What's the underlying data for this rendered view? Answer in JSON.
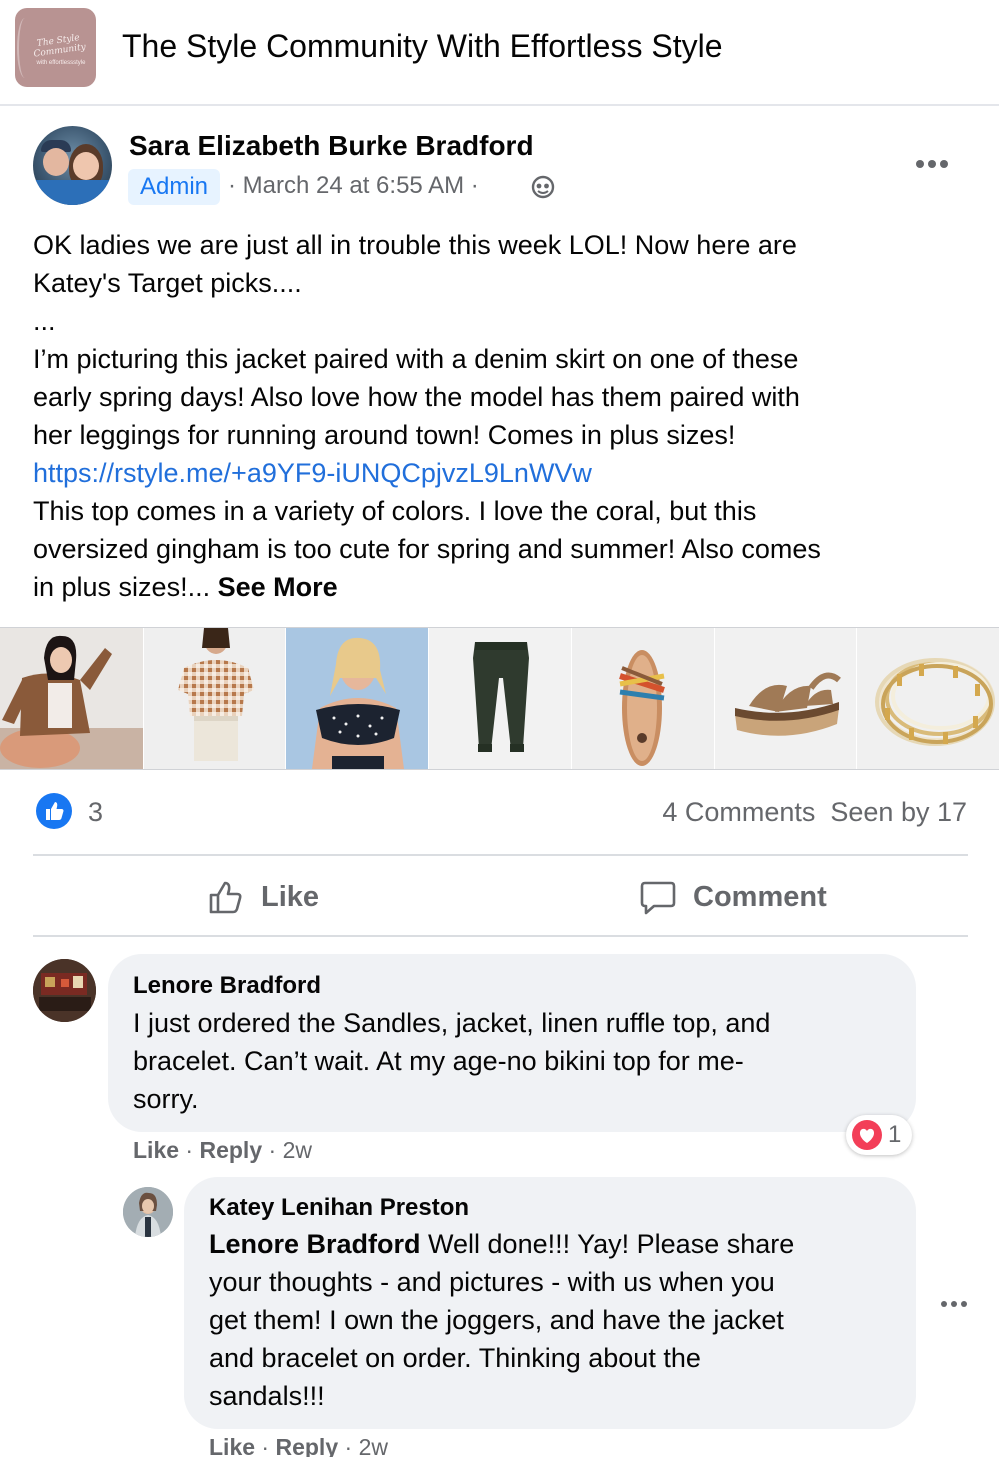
{
  "group": {
    "name": "The Style Community With Effortless Style",
    "logo_script": "The Style Community",
    "logo_sub": "with effortlessstyle",
    "logo_color": "#b89392"
  },
  "post": {
    "author": "Sara Elizabeth Burke Bradford",
    "badge": "Admin",
    "meta": "· March 24 at 6:55 AM ·",
    "privacy_icon": "globe-icon",
    "body_lines": [
      "OK ladies we are just all in trouble this week LOL!  Now here are",
      "Katey's Target picks....",
      "...",
      "I’m picturing this jacket paired with a denim skirt on one of these",
      "early spring days!  Also love how the model has them paired with",
      "her leggings for running around town!  Comes in plus sizes!"
    ],
    "link": "https://rstyle.me/+a9YF9-iUNQCpjvzL9LnWVw",
    "body_lines_after": [
      "This top comes in a variety of colors.  I love the coral, but this",
      "oversized gingham is too cute for spring and summer!  Also comes"
    ],
    "last_line": "in plus sizes!...",
    "see_more": "See More",
    "photos": [
      {
        "name": "model-jacket-photo",
        "bg": "#e9e6e3"
      },
      {
        "name": "gingham-top-photo",
        "bg": "#efefef"
      },
      {
        "name": "bikini-top-photo",
        "bg": "#a9c6e2"
      },
      {
        "name": "joggers-photo",
        "bg": "#f2f2f2"
      },
      {
        "name": "slide-sandal-photo",
        "bg": "#efefef"
      },
      {
        "name": "espadrille-sandal-photo",
        "bg": "#f1f1f1"
      },
      {
        "name": "bracelet-photo",
        "bg": "#f0f0f0"
      }
    ],
    "reaction_count": "3",
    "comments_count": "4 Comments",
    "seen_by": "Seen by 17",
    "like_label": "Like",
    "comment_label": "Comment",
    "accent": "#1877f2"
  },
  "comments": [
    {
      "author": "Lenore Bradford",
      "lines": [
        "I just ordered the Sandles, jacket, linen ruffle top, and",
        "bracelet. Can’t wait. At my age-no bikini top for me-",
        "sorry."
      ],
      "like": "Like",
      "reply": "Reply",
      "time": "2w",
      "reaction_count": "1"
    },
    {
      "author": "Katey Lenihan Preston",
      "mention": "Lenore Bradford",
      "first_line_rest": " Well done!!! Yay! Please share",
      "lines": [
        "your thoughts - and pictures - with us when you",
        "get them! I own the joggers, and have the jacket",
        "and bracelet on order. Thinking about the",
        "sandals!!!"
      ],
      "like": "Like",
      "reply": "Reply",
      "time": "2w"
    }
  ]
}
